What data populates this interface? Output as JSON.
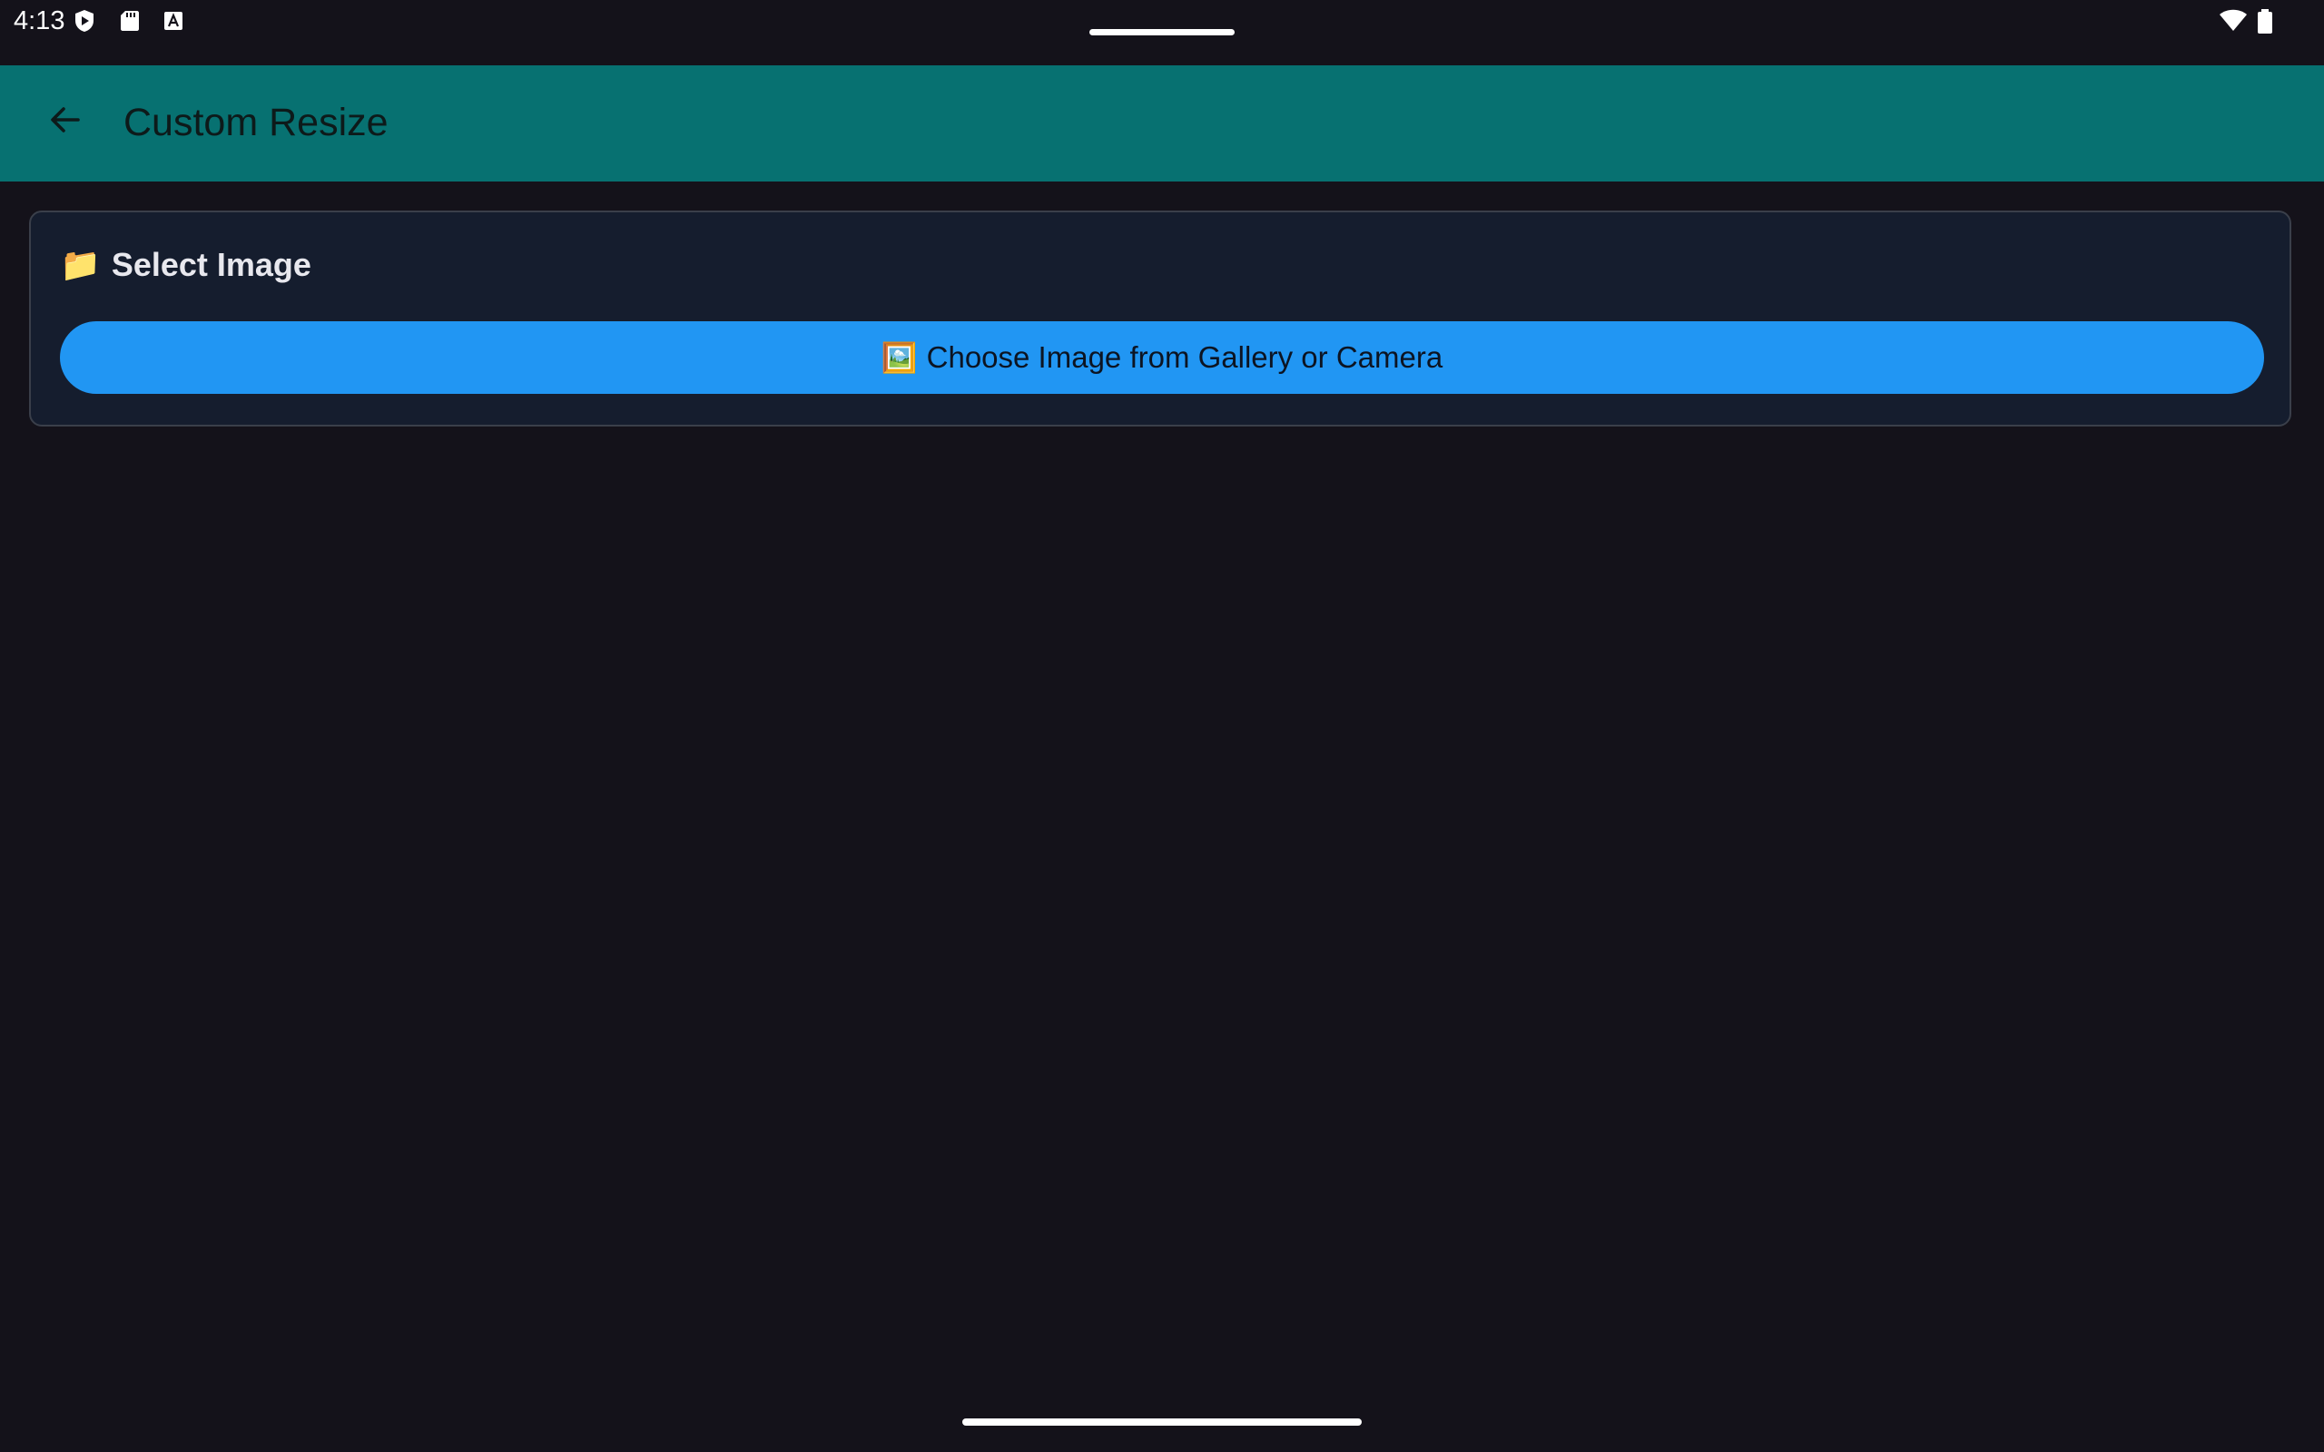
{
  "status_bar": {
    "time": "4:13",
    "left_icons": [
      "play-protect-icon",
      "sd-card-icon",
      "font-a-icon"
    ],
    "right_icons": [
      "wifi-icon",
      "battery-icon"
    ]
  },
  "app_bar": {
    "back_icon": "arrow-back-icon",
    "title": "Custom Resize",
    "background": "#077171"
  },
  "select_card": {
    "title_emoji": "📁",
    "title": "Select Image",
    "button": {
      "emoji": "🖼️",
      "label": "Choose Image from Gallery or Camera",
      "color": "#2196f3"
    }
  }
}
